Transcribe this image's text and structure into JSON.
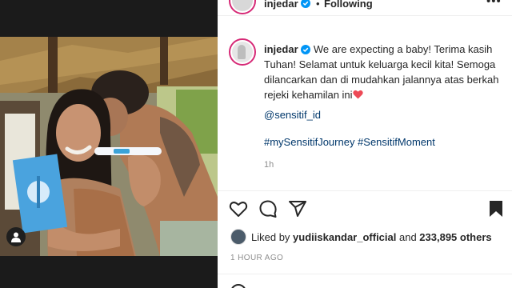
{
  "post": {
    "username": "injedar",
    "follow_status": "Following",
    "more_glyph": "•••",
    "caption_text": " We are expecting a baby! Terima kasih Tuhan! Selamat untuk keluarga kecil kita! Semoga dilancarkan dan di mudahkan jalannya atas berkah rejeki kehamilan ini",
    "mention": "@sensitif_id",
    "hashtags": "#mySensitifJourney #SensitifMoment",
    "caption_time": "1h",
    "liked_by_prefix": "Liked by ",
    "liked_by_user": "yudiiskandar_official",
    "liked_by_mid": " and ",
    "likes_count": "233,895 others",
    "posted_ago": "1 HOUR AGO"
  },
  "colors": {
    "verified": "#0095f6",
    "link": "#00376b",
    "heart": "#ed4956",
    "ring": "#d62976"
  },
  "icons": [
    "heart-icon",
    "comment-icon",
    "share-icon",
    "bookmark-icon",
    "verified-icon",
    "user-tag-icon",
    "more-icon"
  ]
}
